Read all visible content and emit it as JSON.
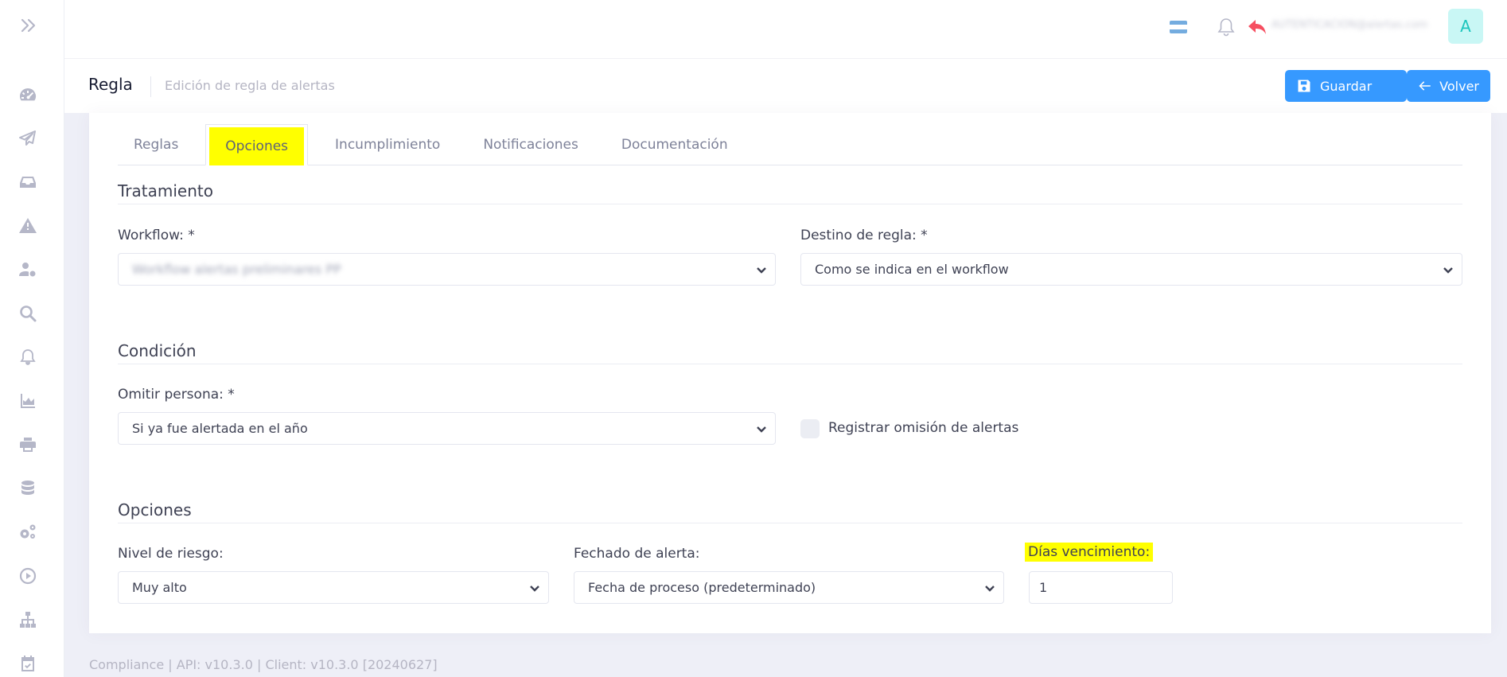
{
  "header": {
    "user_name": "AUTENTICACION@alertas.com",
    "avatar_letter": "A",
    "flag_colors": [
      "#74acdf",
      "#ffffff",
      "#74acdf"
    ]
  },
  "subheader": {
    "title": "Regla",
    "subtitle": "Edición de regla de alertas",
    "save_label": "Guardar",
    "back_label": "Volver"
  },
  "tabs": [
    {
      "label": "Reglas"
    },
    {
      "label": "Opciones"
    },
    {
      "label": "Incumplimiento"
    },
    {
      "label": "Notificaciones"
    },
    {
      "label": "Documentación"
    }
  ],
  "tratamiento": {
    "title": "Tratamiento",
    "workflow_label": "Workflow: *",
    "workflow_value": "Workflow alertas preliminares PP",
    "destino_label": "Destino de regla: *",
    "destino_value": "Como se indica en el workflow"
  },
  "condicion": {
    "title": "Condición",
    "omitir_label": "Omitir persona: *",
    "omitir_value": "Si ya fue alertada en el año",
    "registrar_label": "Registrar omisión de alertas"
  },
  "opciones": {
    "title": "Opciones",
    "riesgo_label": "Nivel de riesgo:",
    "riesgo_value": "Muy alto",
    "fechado_label": "Fechado de alerta:",
    "fechado_value": "Fecha de proceso (predeterminado)",
    "dias_label": "Días vencimiento:",
    "dias_value": "1"
  },
  "footer": {
    "text": "Compliance | API: v10.3.0 | Client: v10.3.0 [20240627]"
  },
  "colors": {
    "primary": "#3699ff",
    "highlight": "#ffff00",
    "undo": "#f64e60",
    "avatar_bg": "#c9f7f5",
    "avatar_fg": "#1bc5bd"
  }
}
